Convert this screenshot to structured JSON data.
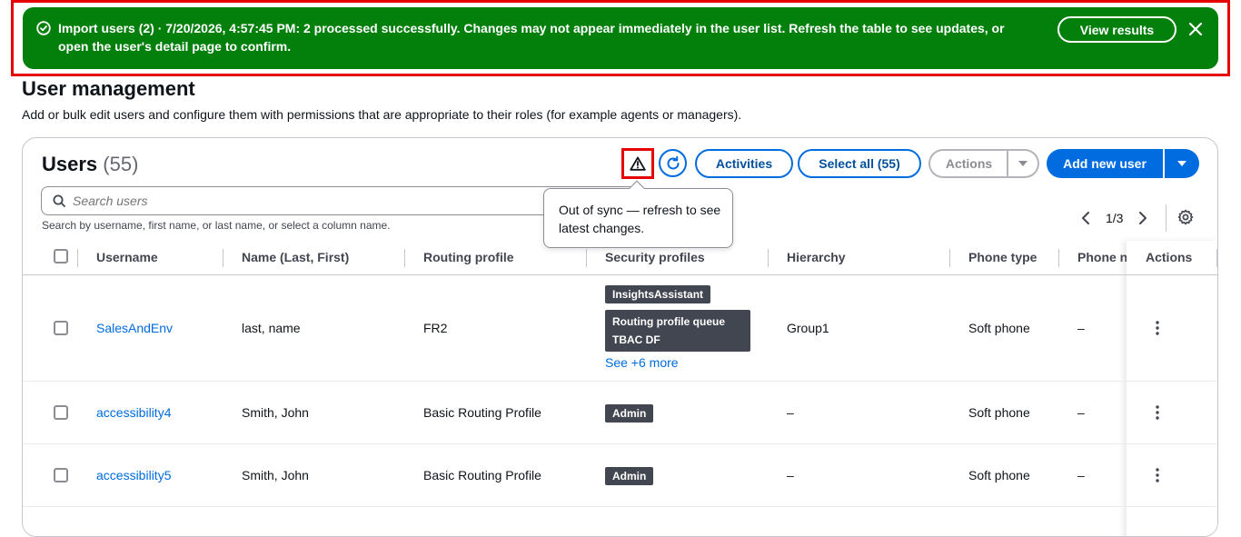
{
  "flash": {
    "message": "Import users (2) · 7/20/2026, 4:57:45 PM: 2 processed successfully. Changes may not appear immediately in the user list. Refresh the table to see updates, or open the user's detail page to confirm.",
    "view_results_label": "View results",
    "color": "#037f0c"
  },
  "page": {
    "title": "User management",
    "description": "Add or bulk edit users and configure them with permissions that are appropriate to their roles (for example agents or managers)."
  },
  "users_table": {
    "heading": "Users",
    "count": "(55)",
    "activities_label": "Activities",
    "select_all_label": "Select all (55)",
    "actions_label": "Actions",
    "add_new_user_label": "Add new user",
    "search_placeholder": "Search users",
    "search_hint": "Search by username, first name, or last name, or select a column name.",
    "tooltip": "Out of sync — refresh to see latest changes.",
    "pagination": "1/3",
    "columns": [
      "Username",
      "Name (Last, First)",
      "Routing profile",
      "Security profiles",
      "Hierarchy",
      "Phone type",
      "Phone n",
      "Actions"
    ],
    "rows": [
      {
        "username": "SalesAndEnv",
        "name": "last, name",
        "routing_profile": "FR2",
        "security_profiles": [
          "InsightsAssistant",
          "Routing profile queue",
          "TBAC DF"
        ],
        "see_more": "See +6 more",
        "hierarchy": "Group1",
        "phone_type": "Soft phone",
        "phone_number": "–"
      },
      {
        "username": "accessibility4",
        "name": "Smith, John",
        "routing_profile": "Basic Routing Profile",
        "security_profiles": [
          "Admin"
        ],
        "hierarchy": "–",
        "phone_type": "Soft phone",
        "phone_number": "–"
      },
      {
        "username": "accessibility5",
        "name": "Smith, John",
        "routing_profile": "Basic Routing Profile",
        "security_profiles": [
          "Admin"
        ],
        "hierarchy": "–",
        "phone_type": "Soft phone",
        "phone_number": "–"
      }
    ]
  },
  "icons": {
    "flash": "success-check-icon",
    "close": "close-icon",
    "warning": "warning-icon",
    "refresh": "refresh-icon",
    "search": "search-icon",
    "settings": "gear-icon",
    "kebab": "more-vertical-icon"
  },
  "colors": {
    "accent": "#006ce0",
    "badge": "#424650",
    "highlight": "#e60000"
  }
}
